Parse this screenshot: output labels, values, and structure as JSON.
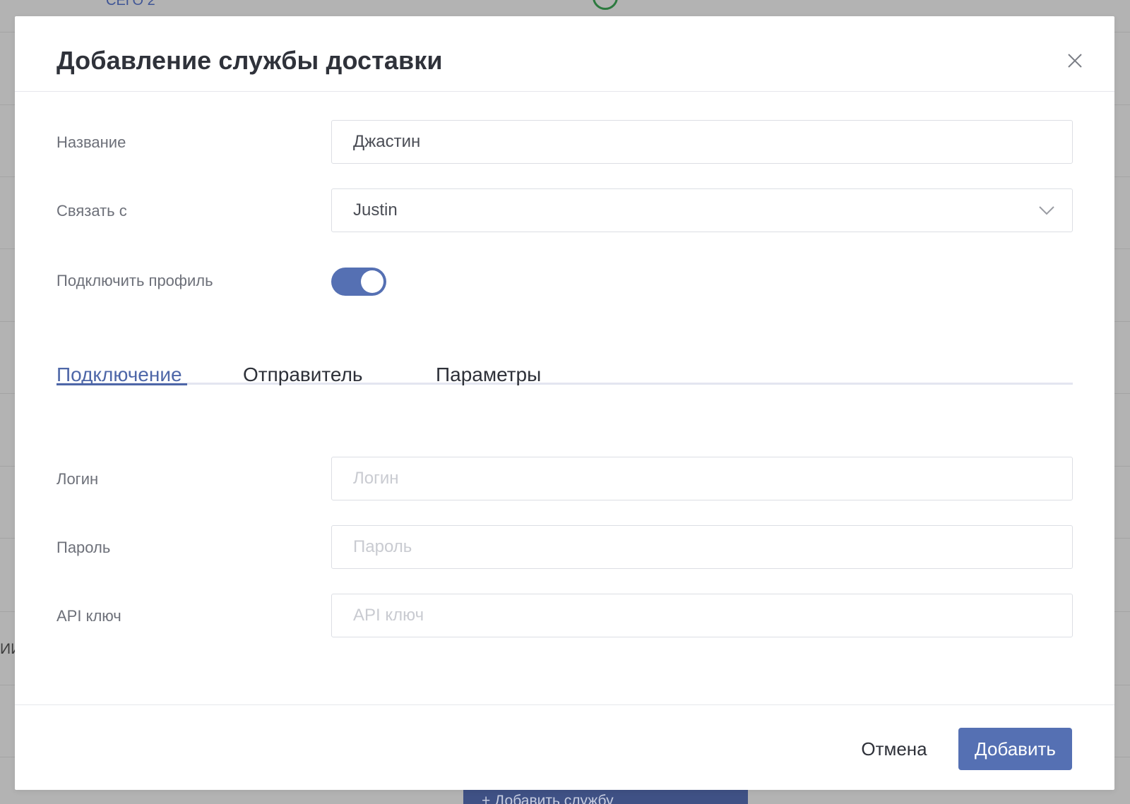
{
  "background": {
    "top_link": "СЕГО 2",
    "side_fragment": "ИИ",
    "bottom_button": "+ Добавить службу"
  },
  "modal": {
    "title": "Добавление службы доставки",
    "fields": {
      "name_label": "Название",
      "name_value": "Джастин",
      "link_label": "Связать с",
      "link_value": "Justin",
      "profile_label": "Подключить профиль",
      "profile_enabled": true
    },
    "tabs": [
      {
        "label": "Подключение",
        "active": true
      },
      {
        "label": "Отправитель",
        "active": false
      },
      {
        "label": "Параметры",
        "active": false
      }
    ],
    "connection": {
      "login_label": "Логин",
      "login_placeholder": "Логин",
      "password_label": "Пароль",
      "password_placeholder": "Пароль",
      "api_label": "API ключ",
      "api_placeholder": "API ключ"
    },
    "footer": {
      "cancel_label": "Отмена",
      "submit_label": "Добавить"
    }
  },
  "colors": {
    "accent": "#5570b3",
    "tab_active": "#4e67a8",
    "overlay": "#b3b3b3"
  },
  "icons": {
    "close": "close-icon",
    "chevron": "chevron-down-icon"
  }
}
